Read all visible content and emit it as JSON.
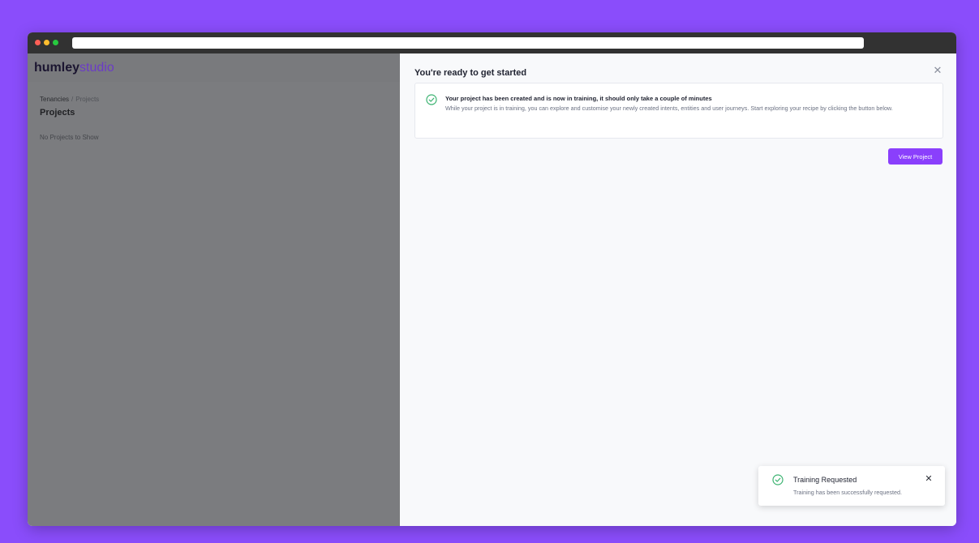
{
  "colors": {
    "background": "#8a4dfb",
    "accent": "#8a3ffc",
    "success": "#3cb371",
    "overlay": "#7b7c7f"
  },
  "browser": {
    "url": ""
  },
  "sidebar": {
    "logo_bold": "humley",
    "logo_light": "studio",
    "breadcrumb": [
      "Tenancies",
      "Projects"
    ],
    "breadcrumb_separator": "/",
    "title": "Projects",
    "empty_message": "No Projects to Show"
  },
  "panel": {
    "title": "You're ready to get started",
    "close_icon": "close-icon",
    "alert": {
      "icon": "check-circle-icon",
      "heading": "Your project has been created and is now in training, it should only take a couple of minutes",
      "body": "While your project is in training, you can explore and customise your newly created intents, entities and user journeys. Start exploring your recipe by clicking the button below."
    },
    "primary_button": "View Project"
  },
  "toast": {
    "icon": "check-circle-icon",
    "title": "Training Requested",
    "message": "Training has been successfully requested.",
    "close_icon": "close-icon"
  }
}
